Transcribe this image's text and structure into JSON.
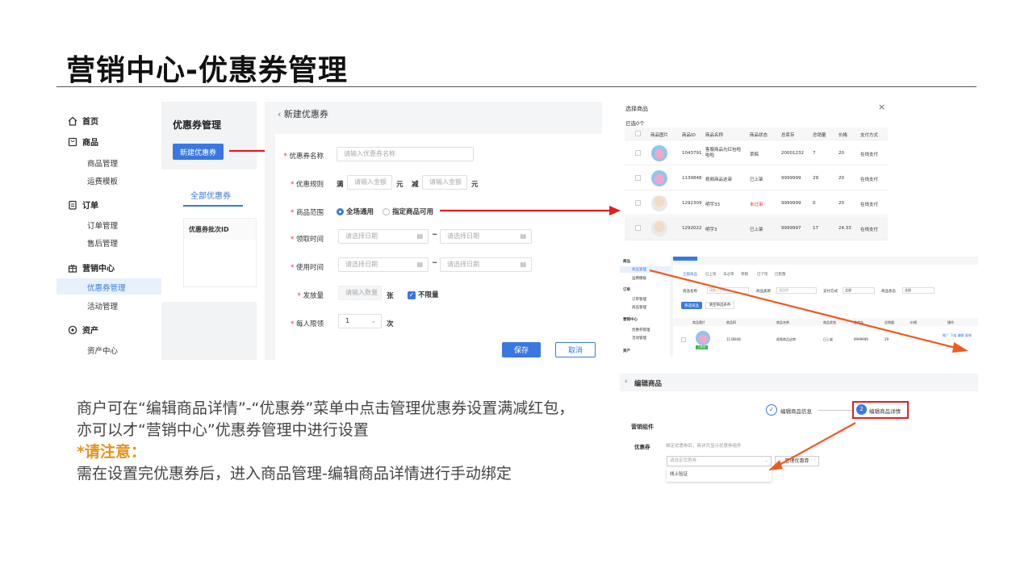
{
  "title": "营销中心-优惠券管理",
  "sidebar": {
    "groups": [
      {
        "label": "首页",
        "icon": "home-icon",
        "items": []
      },
      {
        "label": "商品",
        "icon": "goods-icon",
        "items": [
          "商品管理",
          "运费模板"
        ]
      },
      {
        "label": "订单",
        "icon": "order-icon",
        "items": [
          "订单管理",
          "售后管理"
        ]
      },
      {
        "label": "营销中心",
        "icon": "gift-icon",
        "items": [
          "优惠券管理",
          "活动管理"
        ]
      },
      {
        "label": "资产",
        "icon": "asset-icon",
        "items": [
          "资产中心"
        ]
      }
    ],
    "active": "优惠券管理"
  },
  "coupon_panel": {
    "heading": "优惠券管理",
    "new_button": "新建优惠券",
    "tab": "全部优惠券",
    "column": "优惠券批次ID"
  },
  "form": {
    "back_title": "新建优惠券",
    "name_label": "优惠券名称",
    "name_placeholder": "请输入优惠券名称",
    "rule_label": "优惠规则",
    "rule_full": "满",
    "rule_amount_placeholder": "请输入金额",
    "rule_yuan": "元",
    "rule_minus": "减",
    "range_label": "商品范围",
    "range_all": "全场通用",
    "range_some": "指定商品可用",
    "receive_label": "领取时间",
    "use_label": "使用时间",
    "date_placeholder": "请选择日期",
    "tilde": "~",
    "qty_label": "发放量",
    "qty_placeholder": "请输入数量",
    "qty_unit": "张",
    "unlimited": "不限量",
    "limit_label": "每人限领",
    "limit_value": "1",
    "limit_unit": "次",
    "save": "保存",
    "cancel": "取消"
  },
  "select_goods": {
    "title": "选择商品",
    "selected": "已选0个",
    "headers": [
      "商品图片",
      "商品ID",
      "商品名称",
      "商品状态",
      "总库存",
      "总销量",
      "价格",
      "支付方式"
    ],
    "rows": [
      {
        "id": "1043791",
        "name": "客服商品光红包啦啦啦",
        "status": "草稿",
        "stock": "20001232",
        "sales": "7",
        "price": "20",
        "pay": "在线支付"
      },
      {
        "id": "1139848",
        "name": "视频商品这审",
        "status": "已上架",
        "stock": "9999999",
        "sales": "29",
        "price": "20",
        "pay": "在线支付"
      },
      {
        "id": "1292309",
        "name": "明宇33",
        "status": "未过审",
        "stock": "9999999",
        "sales": "0",
        "price": "20",
        "pay": "在线支付"
      },
      {
        "id": "1292022",
        "name": "明宇3",
        "status": "已上架",
        "stock": "9999997",
        "sales": "17",
        "price": "24.33",
        "pay": "在线支付"
      }
    ]
  },
  "product_mgmt": {
    "sidebar": [
      "商品",
      "商品管理",
      "运费模板",
      "订单",
      "订单管理",
      "商品管理",
      "营销中心",
      "优惠券管理",
      "活动管理",
      "资产"
    ],
    "tabs": [
      "全部商品",
      "已上架",
      "未过审",
      "草稿",
      "已下架",
      "已售罄"
    ],
    "filters": [
      "商品名称",
      "请输入名称",
      "商品类目",
      "请选择",
      "支付方式",
      "全部",
      "商品状态",
      "全部"
    ],
    "buttons": [
      "筛选商品",
      "清空筛选条件"
    ],
    "headers": [
      "商品图片",
      "商品ID",
      "商品名称",
      "商品状态",
      "总库存",
      "总销量",
      "价格",
      "操作"
    ],
    "row": {
      "id": "1136848",
      "name": "视频商品这审",
      "status": "已上架",
      "stock": "9999999",
      "sales": "29",
      "ops": "推广 下架 编辑 复制",
      "badge": "上新品"
    }
  },
  "edit_product": {
    "title": "编辑商品",
    "step1": "编辑商品信息",
    "step2": "编辑商品详情",
    "step2_num": "2",
    "section": "营销组件",
    "coupon_label": "优惠券",
    "hint": "绑定优惠券后，商详页显示优惠券组件",
    "select_placeholder": "请选定优惠券",
    "manage_button": "管理优惠券",
    "option": "线上验证"
  },
  "note": {
    "line1": "商户可在“编辑商品详情”-“优惠券”菜单中点击管理优惠券设置满减红包，",
    "line2": "亦可以才“营销中心”优惠券管理中进行设置",
    "warn": "*请注意：",
    "line3": "需在设置完优惠券后，进入商品管理-编辑商品详情进行手动绑定"
  },
  "colors": {
    "accent": "#3a78e0",
    "arrow": "#e02020",
    "warn": "#e8911a",
    "arrow_orange": "#f05a22"
  }
}
